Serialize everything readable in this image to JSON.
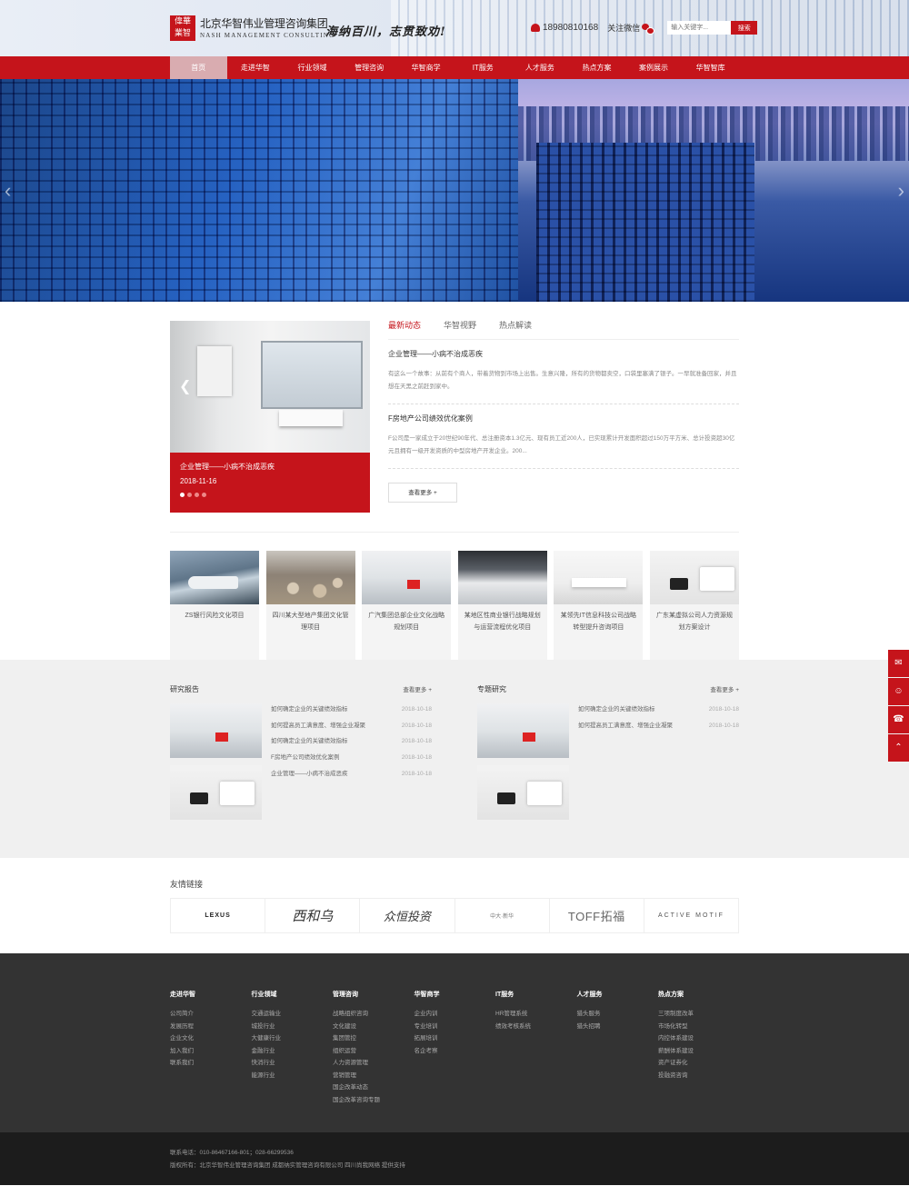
{
  "header": {
    "seal_chars": [
      "偉",
      "華",
      "業",
      "智"
    ],
    "logo_cn": "北京华智伟业管理咨询集团",
    "logo_en": "NASH MANAGEMENT CONSULTING",
    "slogan": "海纳百川，志贯致劝!",
    "phone": "18980810168",
    "wechat_label": "关注微信",
    "search_placeholder": "输入关键字...",
    "search_button": "搜索"
  },
  "nav": [
    "首页",
    "走进华智",
    "行业领域",
    "管理咨询",
    "华智商学",
    "IT服务",
    "人才服务",
    "热点方案",
    "案例展示",
    "华智智库"
  ],
  "news": {
    "slide_title": "企业管理——小病不治成恶疾",
    "slide_date": "2018-11-16",
    "tabs": [
      "最新动态",
      "华智视野",
      "热点解读"
    ],
    "articles": [
      {
        "title": "企业管理——小病不治成恶疾",
        "desc": "有这么一个故事：从前有个商人，带着货物到市场上出售。生意兴隆，所有的货物都卖空，口袋里塞满了银子。一早就准备回家，并且想在天黑之前赶到家中。"
      },
      {
        "title": "F房地产公司绩效优化案例",
        "desc": "F公司是一家成立于20世纪90年代、总注册资本1.3亿元、现有员工近200人，已实现累计开发面积超过150万平方米、总计投资超30亿元且拥有一级开发资质的中型房地产开发企业。200..."
      }
    ],
    "more": "查看更多 +"
  },
  "cases": [
    "ZS银行风险文化项目",
    "四川某大型地产集团文化管理项目",
    "广汽集团总部企业文化战略规划项目",
    "某地区性商业银行战略规划与运营流程优化项目",
    "某领先IT信息科技公司战略转型提升咨询项目",
    "广东某虚拟公司人力资源规划方案设计"
  ],
  "reports": {
    "left": {
      "title": "研究报告",
      "more": "查看更多 +",
      "items": [
        {
          "t": "如何确定企业的关键绩效指标",
          "d": "2018-10-18"
        },
        {
          "t": "如何提高员工满意度、增强企业凝聚",
          "d": "2018-10-18"
        },
        {
          "t": "如何确定企业的关键绩效指标",
          "d": "2018-10-18"
        },
        {
          "t": "F房地产公司绩效优化案例",
          "d": "2018-10-18"
        },
        {
          "t": "企业管理——小病不治成恶疾",
          "d": "2018-10-18"
        }
      ]
    },
    "right": {
      "title": "专题研究",
      "more": "查看更多 +",
      "items": [
        {
          "t": "如何确定企业的关键绩效指标",
          "d": "2018-10-18"
        },
        {
          "t": "如何提高员工满意度、增强企业凝聚",
          "d": "2018-10-18"
        }
      ]
    }
  },
  "links": {
    "title": "友情链接",
    "logos": [
      "LEXUS",
      "西和乌",
      "众恒投资",
      "中大·新华",
      "TOFF拓福",
      "ACTIVE MOTIF"
    ]
  },
  "footer": {
    "cols": [
      {
        "h": "走进华智",
        "items": [
          "公司简介",
          "发展历程",
          "企业文化",
          "加入我们",
          "联系我们"
        ]
      },
      {
        "h": "行业领域",
        "items": [
          "交通运输业",
          "城投行业",
          "大健康行业",
          "金融行业",
          "快消行业",
          "能源行业"
        ]
      },
      {
        "h": "管理咨询",
        "items": [
          "战略组织咨询",
          "文化建设",
          "集团管控",
          "组织运营",
          "人力资源管理",
          "营销管理",
          "国企改革动态",
          "国企改革咨询专题"
        ]
      },
      {
        "h": "华智商学",
        "items": [
          "企业内训",
          "专业培训",
          "拓展培训",
          "名企考察"
        ]
      },
      {
        "h": "IT服务",
        "items": [
          "HR管理系统",
          "绩效考核系统"
        ]
      },
      {
        "h": "人才服务",
        "items": [
          "猎头服务",
          "猎头招聘"
        ]
      },
      {
        "h": "热点方案",
        "items": [
          "三项制度改革",
          "市场化转型",
          "内控体系建设",
          "薪酬体系建设",
          "资产证券化",
          "投融资咨询"
        ]
      }
    ],
    "contact": "联系电话：010-86467166-801；028-66299536",
    "copyright": "版权所有：北京华智伟业管理咨询集团 成都纳实管理咨询有限公司   四川尚我网络 提供支持"
  },
  "side": [
    "chat-icon",
    "qq-icon",
    "phone-icon",
    "top-icon"
  ]
}
